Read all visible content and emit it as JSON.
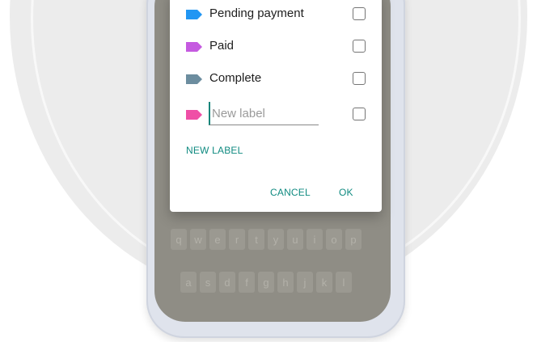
{
  "dialog": {
    "labels": [
      {
        "text": "Pending payment",
        "color": "#2196f3",
        "checked": false
      },
      {
        "text": "Paid",
        "color": "#c55ae0",
        "checked": false
      },
      {
        "text": "Complete",
        "color": "#6c8d9f",
        "checked": false
      }
    ],
    "new_label_input": {
      "placeholder": "New label",
      "value": "",
      "color": "#ef4fa6"
    },
    "new_label_button": "NEW LABEL",
    "cancel_button": "CANCEL",
    "ok_button": "OK"
  },
  "keyboard": {
    "row1": [
      "q",
      "w",
      "e",
      "r",
      "t",
      "y",
      "u",
      "i",
      "o",
      "p"
    ],
    "row2": [
      "a",
      "s",
      "d",
      "f",
      "g",
      "h",
      "j",
      "k",
      "l"
    ]
  },
  "colors": {
    "accent": "#0f8a80"
  }
}
